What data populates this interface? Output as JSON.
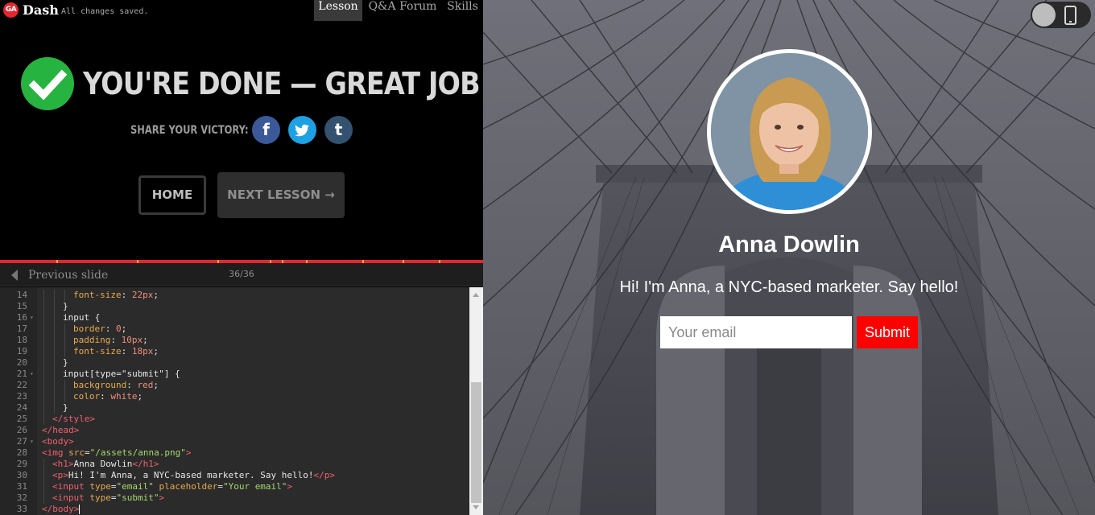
{
  "topbar": {
    "logo_text": "GA",
    "brand": "Dash",
    "save_status": "All changes saved.",
    "tabs": [
      {
        "label": "Lesson",
        "active": true
      },
      {
        "label": "Q&A Forum",
        "active": false
      },
      {
        "label": "Skills",
        "active": false
      }
    ]
  },
  "completion": {
    "title": "YOU'RE DONE — GREAT JOB!",
    "share_label": "SHARE YOUR VICTORY:",
    "share_buttons": [
      {
        "network": "facebook",
        "glyph": "f",
        "icon": "facebook-icon",
        "color": "#3b5998"
      },
      {
        "network": "twitter",
        "glyph": "🐦",
        "icon": "twitter-icon",
        "color": "#1da1e2"
      },
      {
        "network": "tumblr",
        "glyph": "t",
        "icon": "tumblr-icon",
        "color": "#34526f"
      }
    ],
    "home_label": "HOME",
    "next_label": "NEXT LESSON →"
  },
  "slide_nav": {
    "prev_label": "Previous slide",
    "counter": "36/36"
  },
  "editor": {
    "lines": [
      {
        "n": "14",
        "code": [
          [
            "prop",
            "font-size"
          ],
          [
            "txt",
            ": "
          ],
          [
            "num",
            "22px"
          ],
          [
            "txt",
            ";"
          ]
        ],
        "indent": 3
      },
      {
        "n": "15",
        "code": [
          [
            "txt",
            "}"
          ]
        ],
        "indent": 2
      },
      {
        "n": "16",
        "code": [
          [
            "txt",
            "input {"
          ]
        ],
        "indent": 2,
        "fold": true
      },
      {
        "n": "17",
        "code": [
          [
            "prop",
            "border"
          ],
          [
            "txt",
            ": "
          ],
          [
            "num",
            "0"
          ],
          [
            "txt",
            ";"
          ]
        ],
        "indent": 3
      },
      {
        "n": "18",
        "code": [
          [
            "prop",
            "padding"
          ],
          [
            "txt",
            ": "
          ],
          [
            "num",
            "10px"
          ],
          [
            "txt",
            ";"
          ]
        ],
        "indent": 3
      },
      {
        "n": "19",
        "code": [
          [
            "prop",
            "font-size"
          ],
          [
            "txt",
            ": "
          ],
          [
            "num",
            "18px"
          ],
          [
            "txt",
            ";"
          ]
        ],
        "indent": 3
      },
      {
        "n": "20",
        "code": [
          [
            "txt",
            "}"
          ]
        ],
        "indent": 2
      },
      {
        "n": "21",
        "code": [
          [
            "txt",
            "input[type=\"submit\"] {"
          ]
        ],
        "indent": 2,
        "fold": true
      },
      {
        "n": "22",
        "code": [
          [
            "prop",
            "background"
          ],
          [
            "txt",
            ": "
          ],
          [
            "num",
            "red"
          ],
          [
            "txt",
            ";"
          ]
        ],
        "indent": 3
      },
      {
        "n": "23",
        "code": [
          [
            "prop",
            "color"
          ],
          [
            "txt",
            ": "
          ],
          [
            "num",
            "white"
          ],
          [
            "txt",
            ";"
          ]
        ],
        "indent": 3
      },
      {
        "n": "24",
        "code": [
          [
            "txt",
            "}"
          ]
        ],
        "indent": 2
      },
      {
        "n": "25",
        "code": [
          [
            "tag",
            "</style>"
          ]
        ],
        "indent": 1
      },
      {
        "n": "26",
        "code": [
          [
            "tag",
            "</head>"
          ]
        ],
        "indent": 0
      },
      {
        "n": "27",
        "code": [
          [
            "tag",
            "<body>"
          ]
        ],
        "indent": 0,
        "fold": true
      },
      {
        "n": "28",
        "code": [
          [
            "tag",
            "<img "
          ],
          [
            "attr",
            "src"
          ],
          [
            "txt",
            "="
          ],
          [
            "str",
            "\"/assets/anna.png\""
          ],
          [
            "tag",
            ">"
          ]
        ],
        "indent": 0
      },
      {
        "n": "29",
        "code": [
          [
            "tag",
            "<h1>"
          ],
          [
            "txt",
            "Anna Dowlin"
          ],
          [
            "tag",
            "</h1>"
          ]
        ],
        "indent": 1
      },
      {
        "n": "30",
        "code": [
          [
            "tag",
            "<p>"
          ],
          [
            "txt",
            "Hi! I'm Anna, a NYC-based marketer. Say hello!"
          ],
          [
            "tag",
            "</p>"
          ]
        ],
        "indent": 1
      },
      {
        "n": "31",
        "code": [
          [
            "tag",
            "<input "
          ],
          [
            "attr",
            "type"
          ],
          [
            "txt",
            "="
          ],
          [
            "str",
            "\"email\""
          ],
          [
            "txt",
            " "
          ],
          [
            "attr",
            "placeholder"
          ],
          [
            "txt",
            "="
          ],
          [
            "str",
            "\"Your email\""
          ],
          [
            "tag",
            ">"
          ]
        ],
        "indent": 1
      },
      {
        "n": "32",
        "code": [
          [
            "tag",
            "<input "
          ],
          [
            "attr",
            "type"
          ],
          [
            "txt",
            "="
          ],
          [
            "str",
            "\"submit\""
          ],
          [
            "tag",
            ">"
          ]
        ],
        "indent": 1
      },
      {
        "n": "33",
        "code": [
          [
            "tag",
            "</body>"
          ]
        ],
        "indent": 0,
        "cursor": true
      }
    ]
  },
  "preview": {
    "name": "Anna Dowlin",
    "bio": "Hi! I'm Anna, a NYC-based marketer. Say hello!",
    "email_placeholder": "Your email",
    "submit_label": "Submit",
    "accent_color": "#ff0000"
  }
}
